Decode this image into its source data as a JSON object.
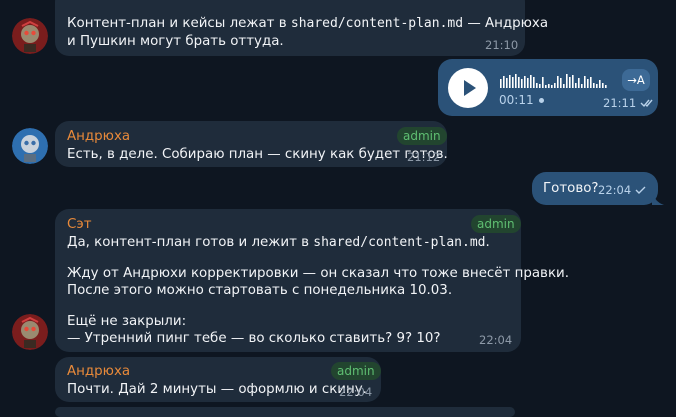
{
  "messages": [
    {
      "text_line1_pre": "Контент-план и кейсы лежат в ",
      "text_line1_code": "shared/content-plan.md",
      "text_line1_post": " — Андрюха",
      "text_line2": "и Пушкин могут брать оттуда.",
      "time": "21:10"
    },
    {
      "duration": "00:11",
      "time": "21:11",
      "transcribe_label": "→A"
    },
    {
      "sender": "Андрюха",
      "badge": "admin",
      "text": "Есть, в деле. Собираю план — скину как будет готов.",
      "time": "21:12"
    },
    {
      "text": "Готово?",
      "time": "22:04"
    },
    {
      "sender": "Сэт",
      "badge": "admin",
      "line1_pre": "Да, контент-план готов и лежит в ",
      "line1_code": "shared/content-plan.md",
      "line1_post": ".",
      "line2": "Жду от Андрюхи корректировки — он сказал что тоже внесёт правки.",
      "line3": "После этого можно стартовать с понедельника 10.03.",
      "line4": "Ещё не закрыли:",
      "line5": "— Утренний пинг тебе — во сколько ставить? 9? 10?",
      "time": "22:04"
    },
    {
      "sender": "Андрюха",
      "badge": "admin",
      "text": "Почти. Дай 2 минуты — оформлю и скину.",
      "time": "22:04"
    }
  ],
  "colors": {
    "background": "#0e1621",
    "incoming_bubble": "#1f2c3b",
    "outgoing_bubble": "#2b5278",
    "sender_name": "#e98a3a",
    "admin_badge": "#5fbf72"
  },
  "icons": [
    "play-icon",
    "double-check-icon",
    "single-check-icon",
    "transcribe-icon",
    "waveform"
  ]
}
